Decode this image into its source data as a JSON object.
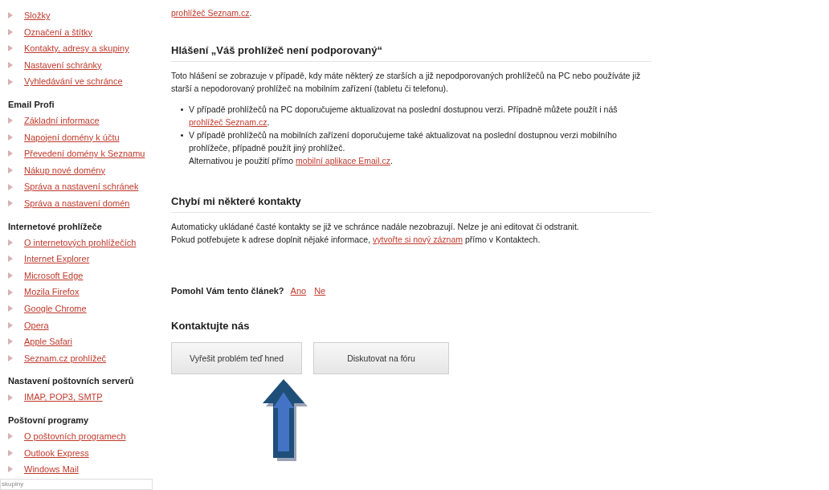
{
  "sidebar": {
    "sections": [
      {
        "items": [
          "Složky",
          "Označení a štítky",
          "Kontakty, adresy a skupiny",
          "Nastavení schránky",
          "Vyhledávání ve schránce"
        ]
      },
      {
        "heading": "Email Profi",
        "items": [
          "Základní informace",
          "Napojení domény k účtu",
          "Převedení domény k Seznamu",
          "Nákup nové domény",
          "Správa a nastavení schránek",
          "Správa a nastavení domén"
        ]
      },
      {
        "heading": "Internetové prohlížeče",
        "items": [
          "O internetových prohlížečích",
          "Internet Explorer",
          "Microsoft Edge",
          "Mozila Firefox",
          "Google Chrome",
          "Opera",
          "Apple Safari",
          "Seznam.cz prohlížeč"
        ]
      },
      {
        "heading": "Nastavení poštovních serverů",
        "items": [
          "IMAP, POP3, SMTP"
        ]
      },
      {
        "heading": "Poštovní programy",
        "items": [
          "O poštovních programech",
          "Outlook Express",
          "Windows Mail"
        ]
      }
    ],
    "search_field": {
      "value": "skupiny"
    }
  },
  "article": {
    "top_line": [
      {
        "kind": "link",
        "text": "prohlížeč Seznam.cz"
      },
      {
        "kind": "text",
        "text": "."
      }
    ],
    "sections": [
      {
        "heading": "Hlášení „Váš prohlížeč není podporovaný“",
        "paragraphs": [
          [
            {
              "kind": "text",
              "text": "Toto hlášení se zobrazuje v případě, kdy máte některý ze starších a již nepodporovaných prohlížečů na PC nebo používáte již starší a nepodorovaný prohlížeč na mobilním zařízení (tabletu či telefonu)."
            }
          ]
        ],
        "bullets": [
          [
            {
              "kind": "text",
              "text": "V případě prohlížečů na PC doporučujeme aktualizovat na poslední dostupnou verzi. Případně můžete použít i náš "
            },
            {
              "kind": "link",
              "text": "prohlížeč Seznam.cz"
            },
            {
              "kind": "text",
              "text": "."
            }
          ],
          [
            {
              "kind": "text",
              "text": "V případě prohlížečů na mobilních zařízení doporučujeme také aktualizovat na poslední dostupnou verzi mobilního prohlížeče, případně použít jiný prohlížeč."
            },
            {
              "kind": "break"
            },
            {
              "kind": "text",
              "text": "Alternativou je použití přímo "
            },
            {
              "kind": "link",
              "text": "mobilní aplikace Email.cz"
            },
            {
              "kind": "text",
              "text": "."
            }
          ]
        ]
      },
      {
        "heading": "Chybí mi některé kontakty",
        "paragraphs": [
          [
            {
              "kind": "text",
              "text": "Automaticky ukládané časté kontakty se již ve schránce nadále nezobrazují. Nelze je ani editovat či odstranit."
            },
            {
              "kind": "break"
            },
            {
              "kind": "text",
              "text": "Pokud potřebujete k adrese doplnit nějaké informace, "
            },
            {
              "kind": "link",
              "text": "vytvořte si nový záznam"
            },
            {
              "kind": "text",
              "text": " přímo v Kontaktech."
            }
          ]
        ]
      }
    ],
    "feedback": {
      "question": "Pomohl Vám tento článek?",
      "answers": [
        "Ano",
        "Ne"
      ]
    },
    "contact": {
      "heading": "Kontaktujte nás",
      "buttons": [
        "Vyřešit problém teď hned",
        "Diskutovat na fóru"
      ]
    }
  }
}
